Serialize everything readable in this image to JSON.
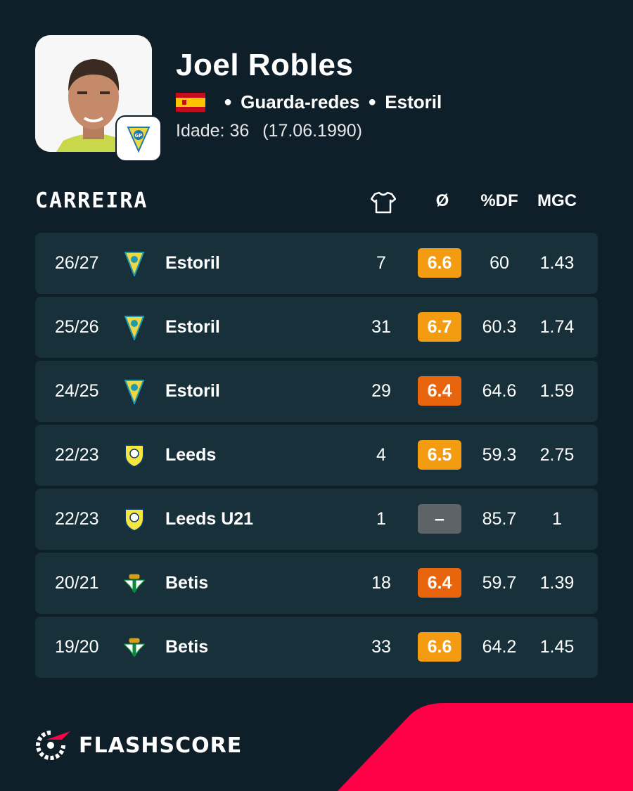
{
  "player": {
    "name": "Joel Robles",
    "position": "Guarda-redes",
    "club": "Estoril",
    "age_label": "Idade: 36",
    "birth_date": "(17.06.1990)"
  },
  "section": {
    "title": "CARREIRA",
    "col_apps_icon": "shirt-icon",
    "col_rating": "Ø",
    "col_pct": "%DF",
    "col_mgc": "MGC"
  },
  "rows": [
    {
      "season": "26/27",
      "club": "Estoril",
      "logo": "estoril",
      "apps": "7",
      "rating": "6.6",
      "rating_color": "#f39c12",
      "pct": "60",
      "mgc": "1.43"
    },
    {
      "season": "25/26",
      "club": "Estoril",
      "logo": "estoril",
      "apps": "31",
      "rating": "6.7",
      "rating_color": "#f39c12",
      "pct": "60.3",
      "mgc": "1.74"
    },
    {
      "season": "24/25",
      "club": "Estoril",
      "logo": "estoril",
      "apps": "29",
      "rating": "6.4",
      "rating_color": "#e8650e",
      "pct": "64.6",
      "mgc": "1.59"
    },
    {
      "season": "22/23",
      "club": "Leeds",
      "logo": "leeds",
      "apps": "4",
      "rating": "6.5",
      "rating_color": "#f39c12",
      "pct": "59.3",
      "mgc": "2.75"
    },
    {
      "season": "22/23",
      "club": "Leeds U21",
      "logo": "leeds",
      "apps": "1",
      "rating": "–",
      "rating_color": "#5d6468",
      "pct": "85.7",
      "mgc": "1"
    },
    {
      "season": "20/21",
      "club": "Betis",
      "logo": "betis",
      "apps": "18",
      "rating": "6.4",
      "rating_color": "#e8650e",
      "pct": "59.7",
      "mgc": "1.39"
    },
    {
      "season": "19/20",
      "club": "Betis",
      "logo": "betis",
      "apps": "33",
      "rating": "6.6",
      "rating_color": "#f39c12",
      "pct": "64.2",
      "mgc": "1.45"
    }
  ],
  "brand": {
    "name": "FLASHSCORE",
    "accent": "#ff0046"
  }
}
